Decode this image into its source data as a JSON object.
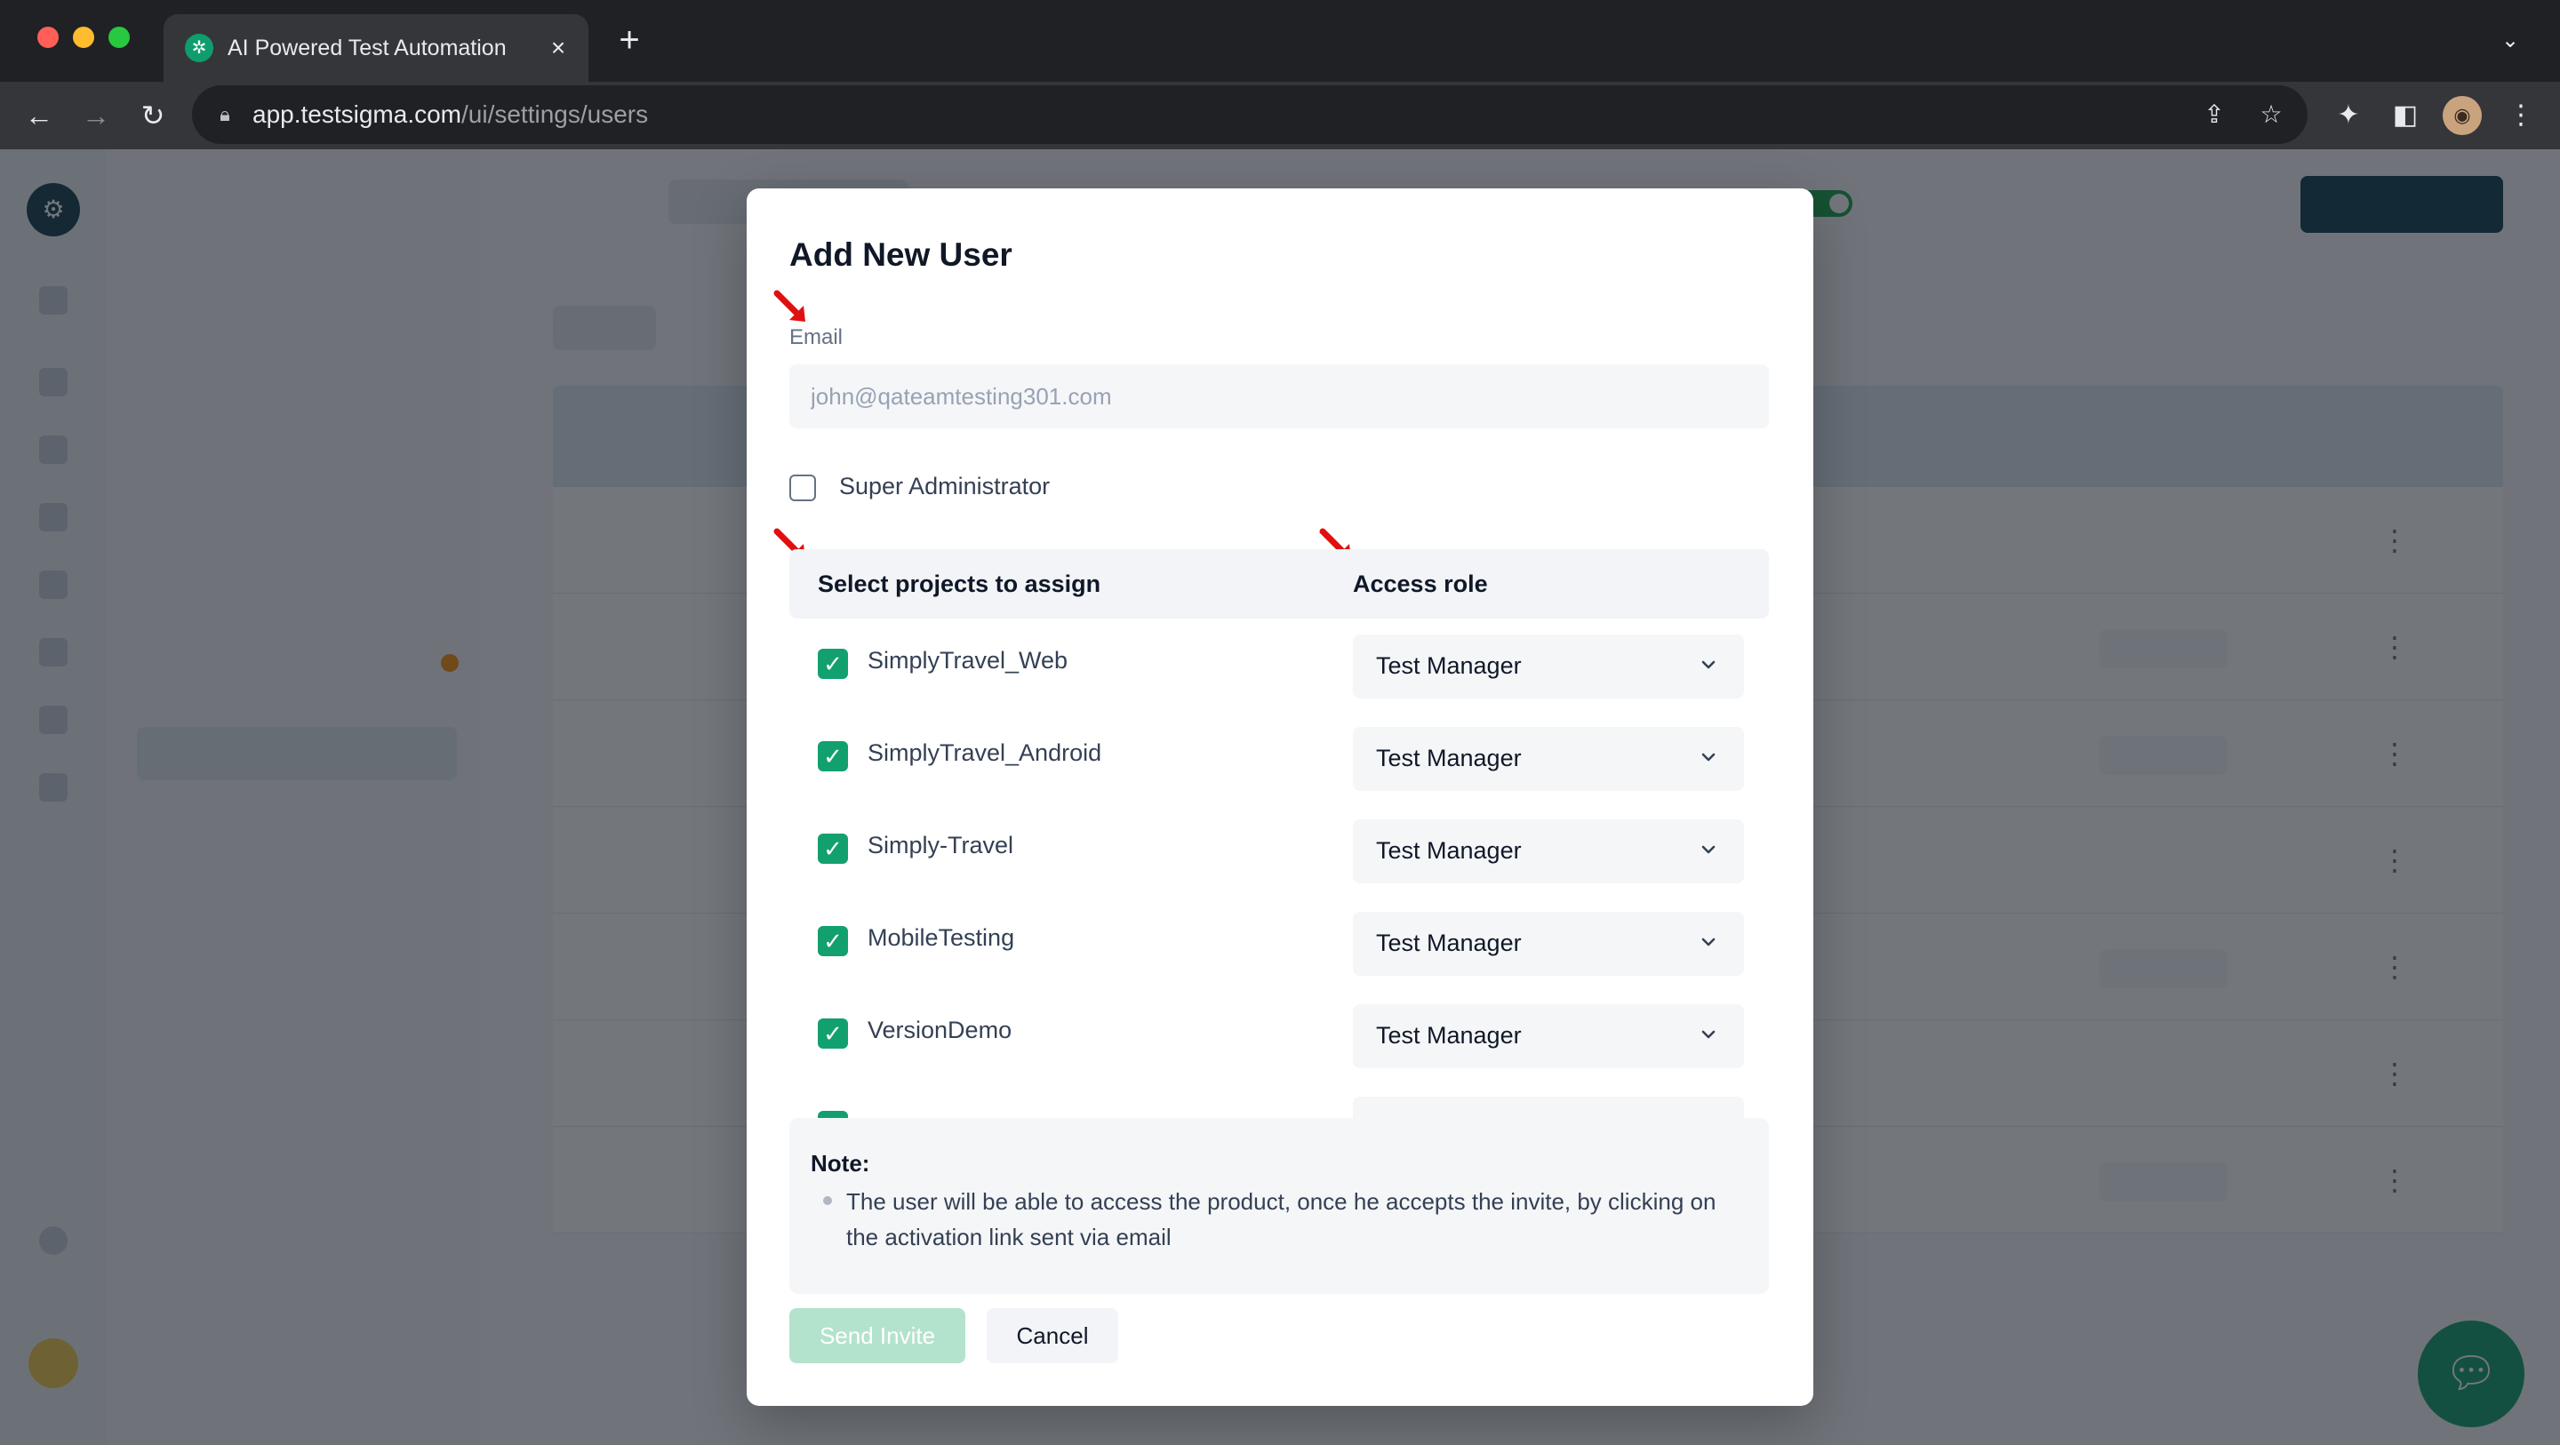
{
  "browser": {
    "tab_title": "AI Powered Test Automation Pl",
    "url_host": "app.testsigma.com",
    "url_path": "/ui/settings/users",
    "icons": {
      "close": "close-icon",
      "new_tab": "plus-icon",
      "back": "arrow-left-icon",
      "forward": "arrow-right-icon",
      "reload": "reload-icon",
      "lock": "lock-icon",
      "share": "share-icon",
      "bookmark": "star-icon",
      "extensions": "puzzle-icon",
      "side_panel": "side-panel-icon",
      "profile": "profile-avatar",
      "menu": "kebab-menu-icon"
    }
  },
  "background": {
    "rows": [
      {
        "name": "",
        "sub": "",
        "status": "",
        "restore": false
      },
      {
        "name": "",
        "sub": "",
        "status": "",
        "restore": true
      },
      {
        "name": "",
        "sub": "",
        "status": "",
        "restore": true
      },
      {
        "name": "",
        "sub": "",
        "status": "",
        "restore": false
      },
      {
        "name": "",
        "sub": "",
        "status": "",
        "restore": true
      },
      {
        "name": "",
        "sub": "",
        "status": "",
        "restore": false
      },
      {
        "name": "",
        "sub": "",
        "status": "",
        "restore": true
      }
    ]
  },
  "modal": {
    "title": "Add New User",
    "email_label": "Email",
    "email_placeholder": "john@qateamtesting301.com",
    "email_value": "",
    "super_admin_label": "Super Administrator",
    "super_admin_checked": false,
    "projects_header": "Select projects to assign",
    "role_header": "Access role",
    "projects": [
      {
        "name": "SimplyTravel_Web",
        "checked": true,
        "role": "Test Manager"
      },
      {
        "name": "SimplyTravel_Android",
        "checked": true,
        "role": "Test Manager"
      },
      {
        "name": "Simply-Travel",
        "checked": true,
        "role": "Test Manager"
      },
      {
        "name": "MobileTesting",
        "checked": true,
        "role": "Test Manager"
      },
      {
        "name": "VersionDemo",
        "checked": true,
        "role": "Test Manager"
      },
      {
        "name": "",
        "checked": true,
        "role": ""
      }
    ],
    "note_title": "Note:",
    "note_text": "The user will be able to access the product, once he accepts the invite, by clicking on the activation link sent via email",
    "send_invite_label": "Send Invite",
    "cancel_label": "Cancel"
  },
  "colors": {
    "accent_green": "#12a06e",
    "send_disabled": "#b3e3cc",
    "annotation_arrow": "#e01010"
  }
}
